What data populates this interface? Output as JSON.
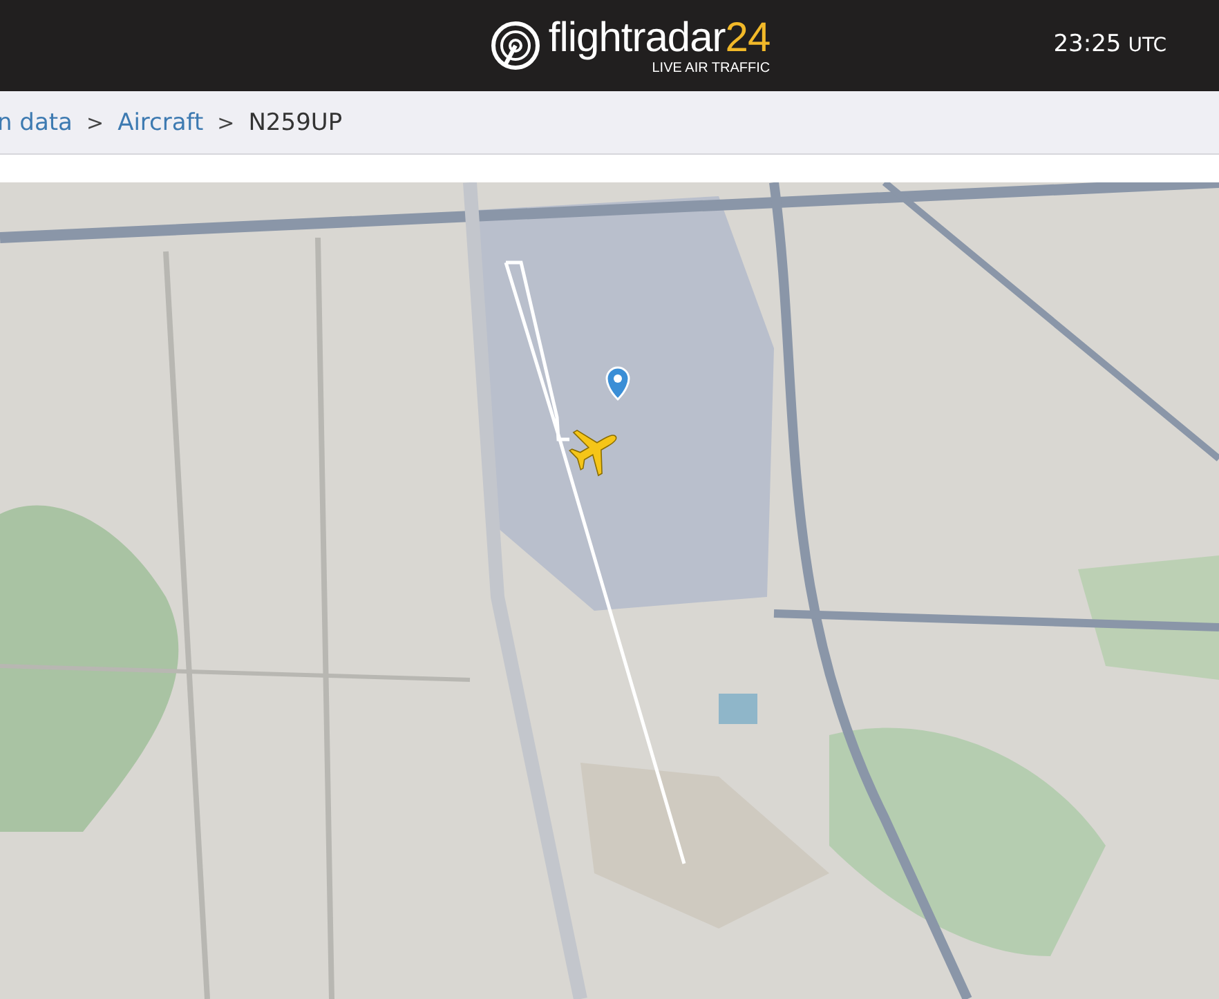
{
  "header": {
    "logo": {
      "name": "flightradar",
      "accent": "24",
      "tagline": "LIVE AIR TRAFFIC"
    },
    "time": "23:25",
    "zone": "UTC"
  },
  "breadcrumb": [
    {
      "kind": "link",
      "label": "n data"
    },
    {
      "kind": "separator",
      "label": ">"
    },
    {
      "kind": "link",
      "label": "Aircraft"
    },
    {
      "kind": "separator",
      "label": ">"
    },
    {
      "kind": "current",
      "label": "N259UP"
    }
  ]
}
